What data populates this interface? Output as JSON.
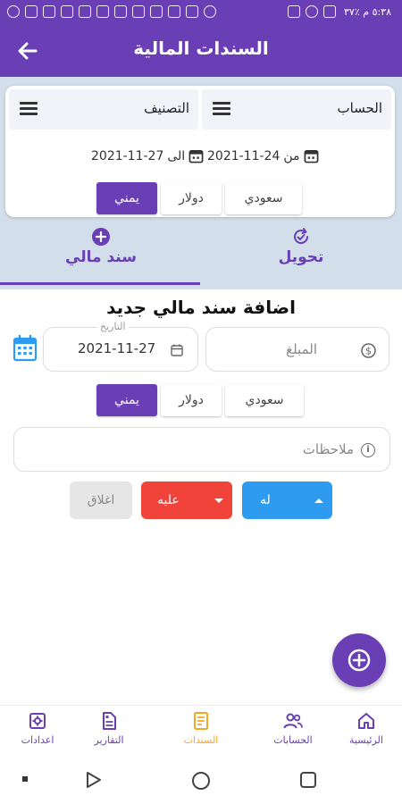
{
  "status_bar": {
    "time": "٥:٣٨ م",
    "battery": "٪٣٧"
  },
  "app_bar": {
    "title": "السندات المالية"
  },
  "filters": {
    "account_label": "الحساب",
    "category_label": "التصنيف",
    "from_label": "من",
    "from_date": "2021-11-24",
    "to_label": "الى",
    "to_date": "2021-11-27",
    "currencies": [
      "سعودي",
      "دولار",
      "يمني"
    ],
    "selected_currency": "يمني"
  },
  "tabs": [
    {
      "label": "تحويل",
      "icon": "refresh-icon"
    },
    {
      "label": "سند مالي",
      "icon": "add-circle-icon",
      "active": true
    }
  ],
  "form": {
    "title": "اضافة سند مالي جديد",
    "amount_placeholder": "المبلغ",
    "date_label": "التاريخ",
    "date_value": "2021-11-27",
    "currencies": [
      "سعودي",
      "دولار",
      "يمني"
    ],
    "selected_currency": "يمني",
    "notes_placeholder": "ملاحظات",
    "credit_button": "له",
    "debit_button": "عليه",
    "close_button": "اغلاق"
  },
  "bottom_nav": [
    {
      "label": "الرئيسية",
      "icon": "home-icon"
    },
    {
      "label": "الحسابات",
      "icon": "users-icon"
    },
    {
      "label": "السندات",
      "icon": "receipt-icon",
      "active": true
    },
    {
      "label": "التقارير",
      "icon": "document-icon"
    },
    {
      "label": "اعدادات",
      "icon": "gear-icon"
    }
  ],
  "colors": {
    "primary": "#6a3fb5",
    "accent": "#f5a623",
    "blue": "#2d9cf0",
    "red": "#f0433a",
    "grey": "#e6e6e6"
  }
}
